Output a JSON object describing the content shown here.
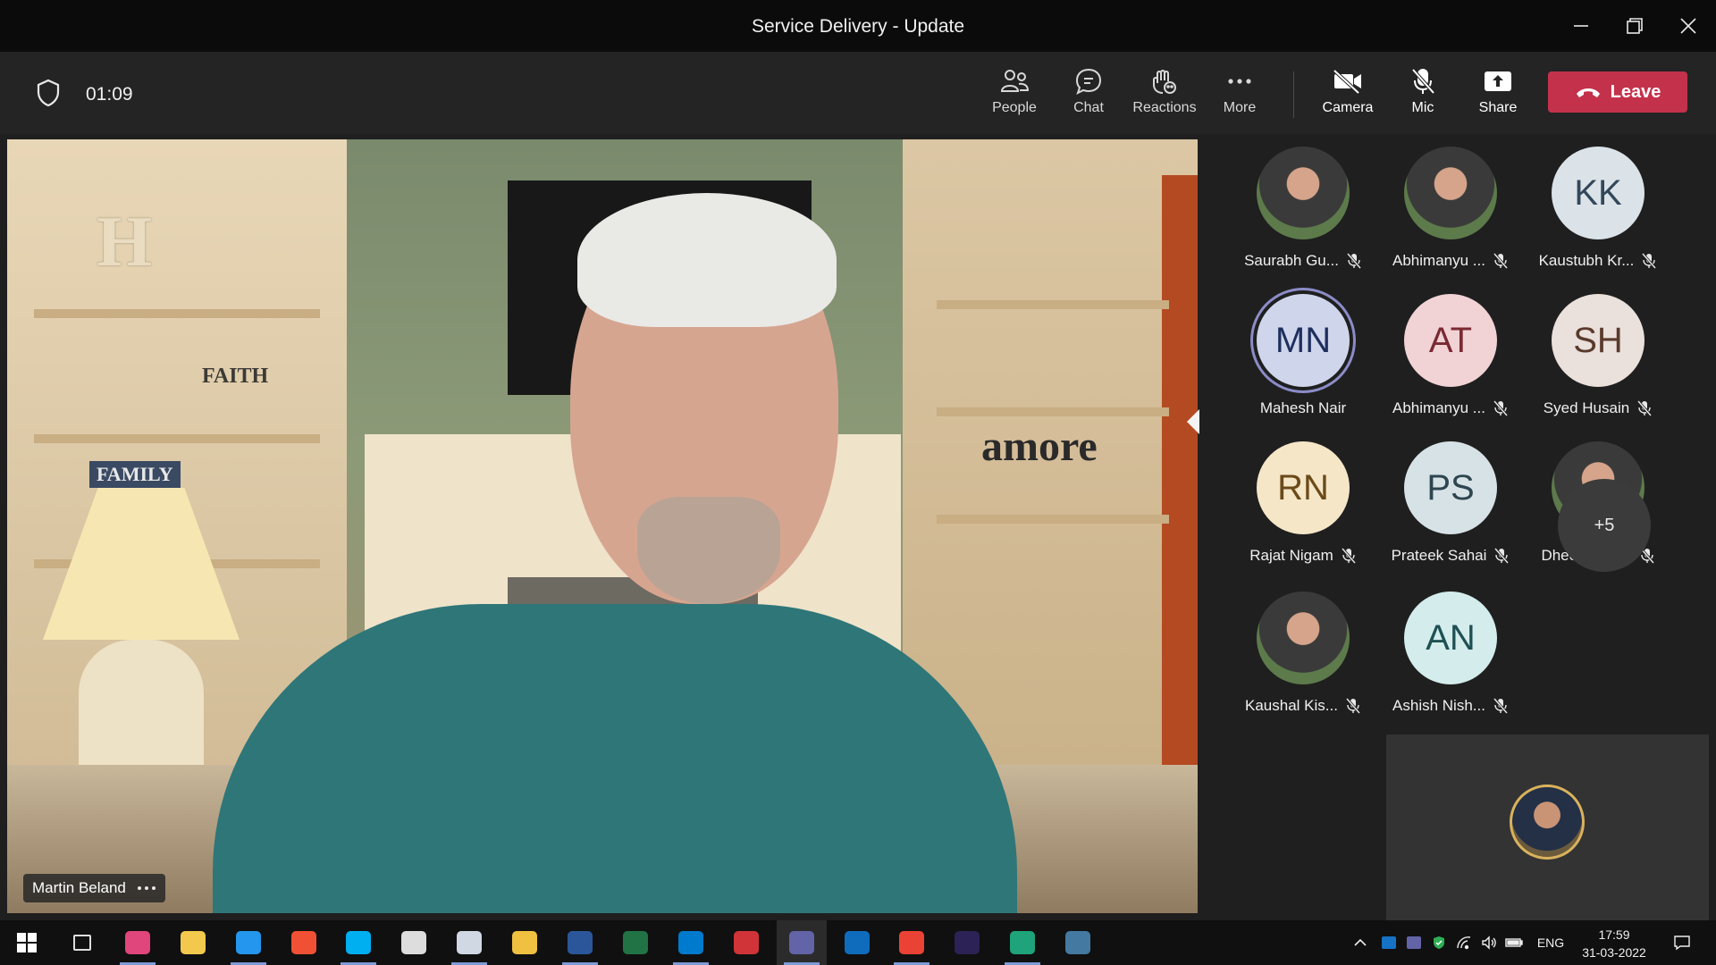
{
  "window": {
    "title": "Service Delivery - Update"
  },
  "meeting": {
    "timer": "01:09",
    "toolbar": {
      "people": "People",
      "chat": "Chat",
      "reactions": "Reactions",
      "more": "More",
      "camera": "Camera",
      "mic": "Mic",
      "share": "Share",
      "leave": "Leave"
    }
  },
  "main_video": {
    "speaker_name": "Martin Beland",
    "wall_words": {
      "h": "H",
      "faith": "FAITH",
      "family": "FAMILY",
      "amore": "amore"
    }
  },
  "participants": [
    {
      "name": "Saurabh Gu...",
      "initials": "",
      "photo": true,
      "muted": true
    },
    {
      "name": "Abhimanyu ...",
      "initials": "",
      "photo": true,
      "muted": true
    },
    {
      "name": "Kaustubh Kr...",
      "initials": "KK",
      "photo": false,
      "muted": true,
      "bg": "#dbe3e9",
      "fg": "#33475b"
    },
    {
      "name": "Mahesh Nair",
      "initials": "MN",
      "photo": false,
      "muted": false,
      "speaking": true,
      "bg": "#cfd6ec",
      "fg": "#1e2f5e"
    },
    {
      "name": "Abhimanyu ...",
      "initials": "AT",
      "photo": false,
      "muted": true,
      "bg": "#f1d3d6",
      "fg": "#7a2a33"
    },
    {
      "name": "Syed Husain",
      "initials": "SH",
      "photo": false,
      "muted": true,
      "bg": "#eae0dc",
      "fg": "#5a3a2c"
    },
    {
      "name": "Rajat Nigam",
      "initials": "RN",
      "photo": false,
      "muted": true,
      "bg": "#f5e6c8",
      "fg": "#6b4a1a"
    },
    {
      "name": "Prateek Sahai",
      "initials": "PS",
      "photo": false,
      "muted": true,
      "bg": "#d7e2e6",
      "fg": "#2d4650"
    },
    {
      "name": "Dheeraj Gu...",
      "initials": "",
      "photo": true,
      "muted": true
    },
    {
      "name": "Kaushal Kis...",
      "initials": "",
      "photo": true,
      "muted": true
    },
    {
      "name": "Ashish Nish...",
      "initials": "AN",
      "photo": false,
      "muted": true,
      "bg": "#d4ecec",
      "fg": "#1f5053"
    }
  ],
  "overflow_count": "+5",
  "taskbar": {
    "apps": [
      "start",
      "task-view",
      "paint",
      "file-explorer",
      "docker",
      "git",
      "skype",
      "penguin",
      "virtualbox",
      "box",
      "word",
      "excel",
      "vscode",
      "firewall",
      "teams",
      "outlook",
      "chrome",
      "eclipse",
      "edge",
      "mysql"
    ],
    "active_app": "teams",
    "language": "ENG",
    "time": "17:59",
    "date": "31-03-2022"
  }
}
